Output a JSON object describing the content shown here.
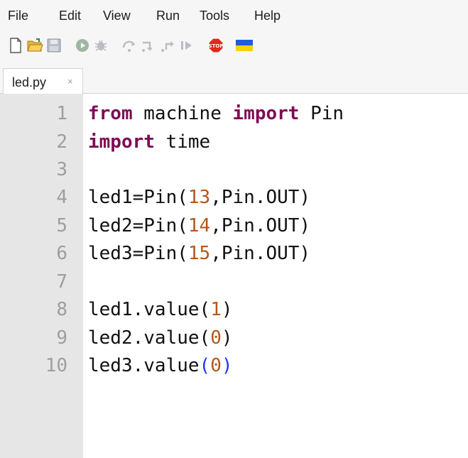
{
  "menu": {
    "file": "File",
    "edit": "Edit",
    "view": "View",
    "run": "Run",
    "tools": "Tools",
    "help": "Help"
  },
  "toolbar": {
    "buttons": [
      {
        "icon": "new-file-icon"
      },
      {
        "icon": "open-folder-icon"
      },
      {
        "icon": "save-icon"
      },
      {
        "icon": "run-icon"
      },
      {
        "icon": "debug-icon"
      },
      {
        "icon": "step-over-icon"
      },
      {
        "icon": "step-into-icon"
      },
      {
        "icon": "step-out-icon"
      },
      {
        "icon": "resume-icon"
      },
      {
        "icon": "stop-icon",
        "label": "STOP"
      },
      {
        "icon": "ukraine-flag-icon"
      }
    ]
  },
  "tabs": [
    {
      "label": "led.py",
      "close": "×"
    }
  ],
  "editor": {
    "line_numbers": [
      "1",
      "2",
      "3",
      "4",
      "5",
      "6",
      "7",
      "8",
      "9",
      "10"
    ],
    "lines": [
      {
        "a": "from",
        "b": " machine ",
        "c": "import",
        "d": " Pin"
      },
      {
        "a": "import",
        "b": " time"
      },
      {},
      {
        "a": "led1=Pin(",
        "n": "13",
        "c": ",Pin.OUT)"
      },
      {
        "a": "led2=Pin(",
        "n": "14",
        "c": ",Pin.OUT)"
      },
      {
        "a": "led3=Pin(",
        "n": "15",
        "c": ",Pin.OUT)"
      },
      {},
      {
        "a": "led1.value(",
        "n": "1",
        "c": ")"
      },
      {
        "a": "led2.value(",
        "n": "0",
        "c": ")"
      },
      {
        "a": "led3.value",
        "p1": "(",
        "n": "0",
        "p2": ")"
      }
    ]
  },
  "colors": {
    "keyword": "#7f0b55",
    "number": "#b5561a",
    "matched_paren": "#1e33ff",
    "gutter_bg": "#e6e6e6",
    "line_number": "#9e9e9e",
    "chrome_bg": "#f6f6f6"
  }
}
